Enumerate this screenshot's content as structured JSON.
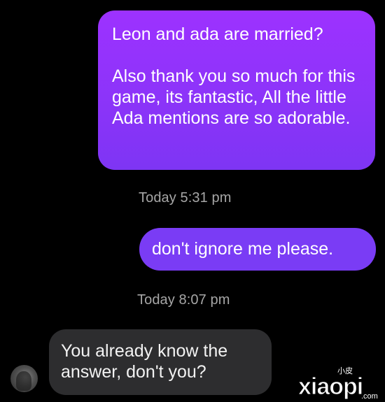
{
  "conversation": {
    "messages": [
      {
        "direction": "sent",
        "text": "Leon and ada are married?\n\nAlso thank you so much for this game, its fantastic, All the little Ada mentions are so adorable."
      },
      {
        "direction": "sent",
        "text": "don't ignore me please."
      },
      {
        "direction": "received",
        "text": "You already know the answer, don't you?"
      }
    ],
    "timestamps": [
      "Today 5:31 pm",
      "Today 8:07 pm"
    ]
  },
  "contact": {
    "avatar_icon": "contact-avatar"
  },
  "watermark": {
    "logo_text": "xiaopi",
    "small_text": "小皮",
    "domain_text": ".com"
  },
  "colors": {
    "background": "#000000",
    "sent_bubble": "#8a35f7",
    "received_bubble": "#2d2d2f",
    "timestamp": "#a6a6a6"
  }
}
